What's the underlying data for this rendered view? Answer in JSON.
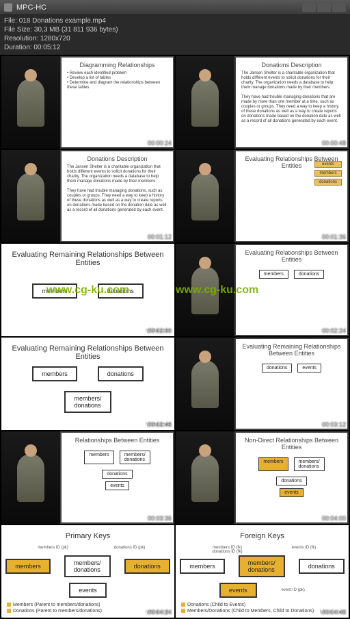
{
  "titlebar": {
    "app": "MPC-HC"
  },
  "meta": {
    "file_label": "File:",
    "file": "018 Donations example.mp4",
    "size_label": "File Size:",
    "size": "30,3 MB (31 811 936 bytes)",
    "res_label": "Resolution:",
    "res": "1280x720",
    "dur_label": "Duration:",
    "dur": "00:05:12"
  },
  "watermark": "www.cg-ku.com",
  "brand": "lynda.com",
  "thumbs": [
    {
      "ts": "00:00:24",
      "title": "Diagramming Relationships",
      "body": "• Review each identified problem\n• Develop a list of tables\n• Determine and diagram the relationships between these tables"
    },
    {
      "ts": "00:00:48",
      "title": "Donations Description",
      "body": "The Jansen Shelter is a charitable organization that holds different events to solicit donations for their charity. The organization needs a database to help them manage donations made by their members.\n\nThey have had trouble managing donations that are made by more than one member at a time, such as couples or groups. They need a way to keep a history of these donations as well as a way to create reports on donations made based on the donation date as well as a record of all donations generated by each event."
    },
    {
      "ts": "00:01:12",
      "title": "Donations Description",
      "body": "The Jansen Shelter is a charitable organization that holds different events to solicit donations for their charity. The organization needs a database to help them manage donations made by their members.\n\nThey have had trouble managing donations, such as couples or groups. They need a way to keep a history of these donations as well as a way to create reports on donations made based on the donation date as well as a record of all donations generated by each event."
    },
    {
      "ts": "00:01:36",
      "title": "Evaluating Relationships Between Entities",
      "side": [
        "events",
        "members",
        "donations"
      ]
    },
    {
      "ts": "00:02:00",
      "title": "Evaluating Remaining Relationships Between Entities",
      "entities": [
        "members",
        "donations"
      ],
      "slide": true
    },
    {
      "ts": "00:02:24",
      "title": "Evaluating Relationships Between Entities",
      "row": [
        "members",
        "donations"
      ]
    },
    {
      "ts": "00:02:48",
      "title": "Evaluating Remaining Relationships Between Entities",
      "entities": [
        "members",
        "donations"
      ],
      "junction": "members/\ndonations",
      "slide": true
    },
    {
      "ts": "00:03:12",
      "title": "Evaluating Remaining Relationships Between Entities",
      "row": [
        "donations",
        "events"
      ]
    },
    {
      "ts": "00:03:36",
      "title": "Relationships Between Entities",
      "three": [
        "members",
        "members/\ndonations",
        "donations"
      ],
      "below": "events"
    },
    {
      "ts": "00:04:00",
      "title": "Non-Direct Relationships Between Entities",
      "three": [
        "members",
        "members/\ndonations",
        "donations"
      ],
      "below": "events",
      "hl": [
        0,
        3
      ]
    },
    {
      "ts": "00:04:24",
      "title": "Primary Keys",
      "slide": true,
      "pkfk": true,
      "k1": "members ID (pk)",
      "k2": "donations ID (pk)",
      "three": [
        "members",
        "members/\ndonations",
        "donations"
      ],
      "below": "events",
      "hl": [
        0,
        2
      ],
      "legend": [
        "Members (Parent to members/donations)",
        "Donations (Parent to members/donations)"
      ]
    },
    {
      "ts": "00:04:48",
      "title": "Foreign Keys",
      "slide": true,
      "pkfk": true,
      "k1": "members ID (fk)\ndonations ID (fk)",
      "k2": "events ID (fk)",
      "klabel2": "event ID (pk)",
      "three": [
        "members",
        "members/\ndonations",
        "donations"
      ],
      "below": "events",
      "hl": [
        1,
        3
      ],
      "legend": [
        "Donations (Child to Events)",
        "Members/Donations (Child to Members, Child to Donations)"
      ]
    }
  ]
}
